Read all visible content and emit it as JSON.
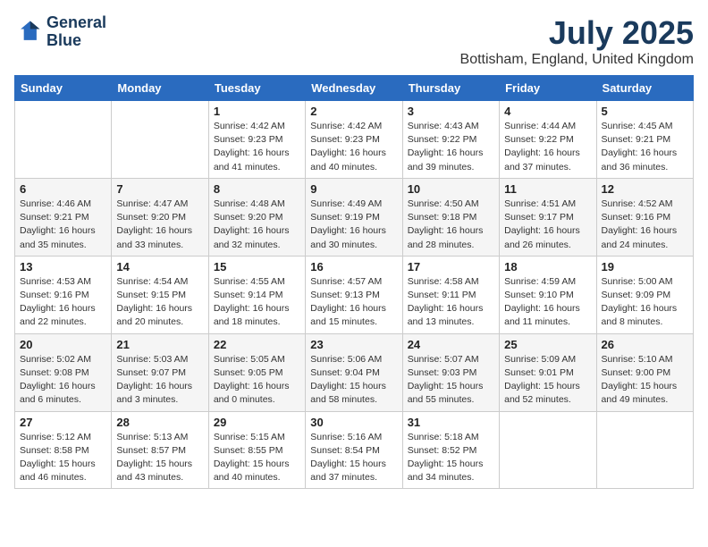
{
  "header": {
    "logo_line1": "General",
    "logo_line2": "Blue",
    "title": "July 2025",
    "location": "Bottisham, England, United Kingdom"
  },
  "weekdays": [
    "Sunday",
    "Monday",
    "Tuesday",
    "Wednesday",
    "Thursday",
    "Friday",
    "Saturday"
  ],
  "weeks": [
    [
      {
        "day": "",
        "info": ""
      },
      {
        "day": "",
        "info": ""
      },
      {
        "day": "1",
        "info": "Sunrise: 4:42 AM\nSunset: 9:23 PM\nDaylight: 16 hours and 41 minutes."
      },
      {
        "day": "2",
        "info": "Sunrise: 4:42 AM\nSunset: 9:23 PM\nDaylight: 16 hours and 40 minutes."
      },
      {
        "day": "3",
        "info": "Sunrise: 4:43 AM\nSunset: 9:22 PM\nDaylight: 16 hours and 39 minutes."
      },
      {
        "day": "4",
        "info": "Sunrise: 4:44 AM\nSunset: 9:22 PM\nDaylight: 16 hours and 37 minutes."
      },
      {
        "day": "5",
        "info": "Sunrise: 4:45 AM\nSunset: 9:21 PM\nDaylight: 16 hours and 36 minutes."
      }
    ],
    [
      {
        "day": "6",
        "info": "Sunrise: 4:46 AM\nSunset: 9:21 PM\nDaylight: 16 hours and 35 minutes."
      },
      {
        "day": "7",
        "info": "Sunrise: 4:47 AM\nSunset: 9:20 PM\nDaylight: 16 hours and 33 minutes."
      },
      {
        "day": "8",
        "info": "Sunrise: 4:48 AM\nSunset: 9:20 PM\nDaylight: 16 hours and 32 minutes."
      },
      {
        "day": "9",
        "info": "Sunrise: 4:49 AM\nSunset: 9:19 PM\nDaylight: 16 hours and 30 minutes."
      },
      {
        "day": "10",
        "info": "Sunrise: 4:50 AM\nSunset: 9:18 PM\nDaylight: 16 hours and 28 minutes."
      },
      {
        "day": "11",
        "info": "Sunrise: 4:51 AM\nSunset: 9:17 PM\nDaylight: 16 hours and 26 minutes."
      },
      {
        "day": "12",
        "info": "Sunrise: 4:52 AM\nSunset: 9:16 PM\nDaylight: 16 hours and 24 minutes."
      }
    ],
    [
      {
        "day": "13",
        "info": "Sunrise: 4:53 AM\nSunset: 9:16 PM\nDaylight: 16 hours and 22 minutes."
      },
      {
        "day": "14",
        "info": "Sunrise: 4:54 AM\nSunset: 9:15 PM\nDaylight: 16 hours and 20 minutes."
      },
      {
        "day": "15",
        "info": "Sunrise: 4:55 AM\nSunset: 9:14 PM\nDaylight: 16 hours and 18 minutes."
      },
      {
        "day": "16",
        "info": "Sunrise: 4:57 AM\nSunset: 9:13 PM\nDaylight: 16 hours and 15 minutes."
      },
      {
        "day": "17",
        "info": "Sunrise: 4:58 AM\nSunset: 9:11 PM\nDaylight: 16 hours and 13 minutes."
      },
      {
        "day": "18",
        "info": "Sunrise: 4:59 AM\nSunset: 9:10 PM\nDaylight: 16 hours and 11 minutes."
      },
      {
        "day": "19",
        "info": "Sunrise: 5:00 AM\nSunset: 9:09 PM\nDaylight: 16 hours and 8 minutes."
      }
    ],
    [
      {
        "day": "20",
        "info": "Sunrise: 5:02 AM\nSunset: 9:08 PM\nDaylight: 16 hours and 6 minutes."
      },
      {
        "day": "21",
        "info": "Sunrise: 5:03 AM\nSunset: 9:07 PM\nDaylight: 16 hours and 3 minutes."
      },
      {
        "day": "22",
        "info": "Sunrise: 5:05 AM\nSunset: 9:05 PM\nDaylight: 16 hours and 0 minutes."
      },
      {
        "day": "23",
        "info": "Sunrise: 5:06 AM\nSunset: 9:04 PM\nDaylight: 15 hours and 58 minutes."
      },
      {
        "day": "24",
        "info": "Sunrise: 5:07 AM\nSunset: 9:03 PM\nDaylight: 15 hours and 55 minutes."
      },
      {
        "day": "25",
        "info": "Sunrise: 5:09 AM\nSunset: 9:01 PM\nDaylight: 15 hours and 52 minutes."
      },
      {
        "day": "26",
        "info": "Sunrise: 5:10 AM\nSunset: 9:00 PM\nDaylight: 15 hours and 49 minutes."
      }
    ],
    [
      {
        "day": "27",
        "info": "Sunrise: 5:12 AM\nSunset: 8:58 PM\nDaylight: 15 hours and 46 minutes."
      },
      {
        "day": "28",
        "info": "Sunrise: 5:13 AM\nSunset: 8:57 PM\nDaylight: 15 hours and 43 minutes."
      },
      {
        "day": "29",
        "info": "Sunrise: 5:15 AM\nSunset: 8:55 PM\nDaylight: 15 hours and 40 minutes."
      },
      {
        "day": "30",
        "info": "Sunrise: 5:16 AM\nSunset: 8:54 PM\nDaylight: 15 hours and 37 minutes."
      },
      {
        "day": "31",
        "info": "Sunrise: 5:18 AM\nSunset: 8:52 PM\nDaylight: 15 hours and 34 minutes."
      },
      {
        "day": "",
        "info": ""
      },
      {
        "day": "",
        "info": ""
      }
    ]
  ]
}
